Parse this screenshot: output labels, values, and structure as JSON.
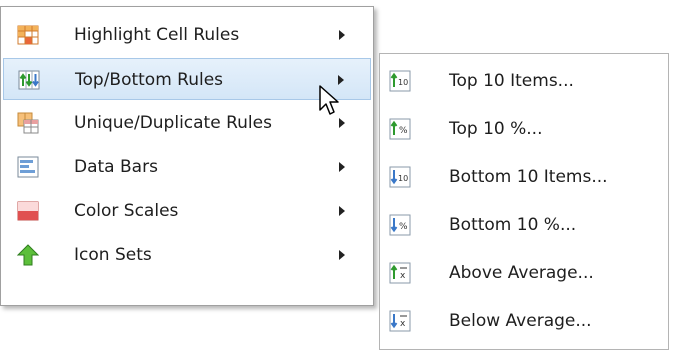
{
  "main_menu": {
    "items": [
      {
        "label": "Highlight Cell Rules",
        "icon": "highlight-cells-icon",
        "has_submenu": true
      },
      {
        "label": "Top/Bottom Rules",
        "icon": "top-bottom-rules-icon",
        "has_submenu": true,
        "state": "hover"
      },
      {
        "label": "Unique/Duplicate Rules",
        "icon": "unique-duplicate-icon",
        "has_submenu": true
      },
      {
        "label": "Data Bars",
        "icon": "data-bars-icon",
        "has_submenu": true
      },
      {
        "label": "Color Scales",
        "icon": "color-scales-icon",
        "has_submenu": true
      },
      {
        "label": "Icon Sets",
        "icon": "icon-sets-icon",
        "has_submenu": true
      }
    ]
  },
  "sub_menu": {
    "items": [
      {
        "label": "Top 10 Items...",
        "icon": "top-10-items-icon"
      },
      {
        "label": "Top 10 %...",
        "icon": "top-10-percent-icon"
      },
      {
        "label": "Bottom 10 Items...",
        "icon": "bottom-10-items-icon"
      },
      {
        "label": "Bottom 10 %...",
        "icon": "bottom-10-percent-icon"
      },
      {
        "label": "Above Average...",
        "icon": "above-average-icon"
      },
      {
        "label": "Below Average...",
        "icon": "below-average-icon"
      }
    ]
  },
  "colors": {
    "hover_bg": "#d4e6f7",
    "hover_border": "#a8c8e8",
    "green_arrow": "#2e9a2e",
    "blue_arrow": "#3a78c8",
    "red_scale": "#e05050"
  }
}
